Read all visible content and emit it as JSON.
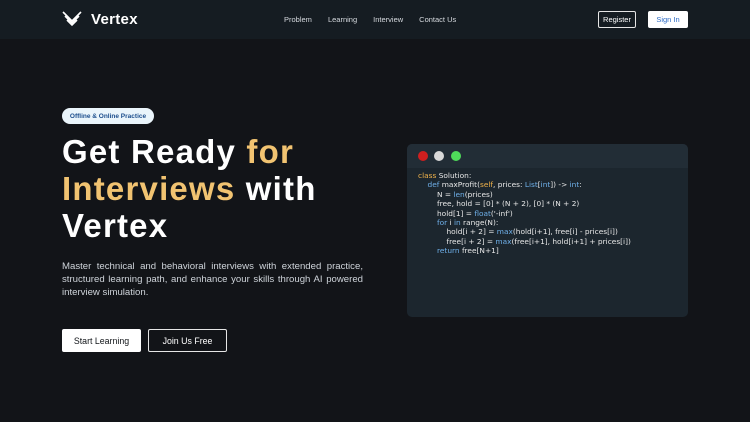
{
  "nav": {
    "brand": "Vertex",
    "links": [
      "Problem",
      "Learning",
      "Interview",
      "Contact Us"
    ],
    "register_label": "Register",
    "signin_label": "Sign In"
  },
  "hero": {
    "badge": "Offline & Online Practice",
    "headline": {
      "line1_a": "Get Ready ",
      "line1_b": "for",
      "line2_a": "Interviews",
      "line2_b": " with",
      "line3": "Vertex"
    },
    "description": "Master technical and behavioral interviews with extended practice, structured learning path, and enhance your skills through AI powered interview simulation.",
    "start_label": "Start Learning",
    "join_label": "Join Us Free"
  },
  "code": {
    "lines": [
      {
        "indent": 0,
        "tokens": [
          {
            "t": "class",
            "c": "kw"
          },
          {
            "t": " Solution:",
            "c": ""
          }
        ]
      },
      {
        "indent": 1,
        "tokens": [
          {
            "t": "def",
            "c": "bi"
          },
          {
            "t": " maxProfit(",
            "c": ""
          },
          {
            "t": "self",
            "c": "kw"
          },
          {
            "t": ", prices: ",
            "c": ""
          },
          {
            "t": "List",
            "c": "bi"
          },
          {
            "t": "[",
            "c": ""
          },
          {
            "t": "int",
            "c": "bi"
          },
          {
            "t": "]) -> ",
            "c": ""
          },
          {
            "t": "int",
            "c": "bi"
          },
          {
            "t": ":",
            "c": ""
          }
        ]
      },
      {
        "indent": 2,
        "tokens": [
          {
            "t": "N = ",
            "c": ""
          },
          {
            "t": "len",
            "c": "bi"
          },
          {
            "t": "(prices)",
            "c": ""
          }
        ]
      },
      {
        "indent": 2,
        "tokens": [
          {
            "t": "free, hold = [0] * (N + 2), [0] * (N + 2)",
            "c": ""
          }
        ]
      },
      {
        "indent": 2,
        "tokens": [
          {
            "t": "hold[1] = ",
            "c": ""
          },
          {
            "t": "float",
            "c": "bi"
          },
          {
            "t": "('-inf')",
            "c": ""
          }
        ]
      },
      {
        "indent": 2,
        "tokens": [
          {
            "t": "for",
            "c": "bi"
          },
          {
            "t": " i ",
            "c": ""
          },
          {
            "t": "in",
            "c": "bi"
          },
          {
            "t": " range(N):",
            "c": ""
          }
        ]
      },
      {
        "indent": 3,
        "tokens": [
          {
            "t": "hold[i + 2] = ",
            "c": ""
          },
          {
            "t": "max",
            "c": "bi"
          },
          {
            "t": "(hold[i+1], free[i] - prices[i])",
            "c": ""
          }
        ]
      },
      {
        "indent": 3,
        "tokens": [
          {
            "t": "free[i + 2] = ",
            "c": ""
          },
          {
            "t": "max",
            "c": "bi"
          },
          {
            "t": "(free[i+1], hold[i+1] + prices[i])",
            "c": ""
          }
        ]
      },
      {
        "indent": 2,
        "tokens": [
          {
            "t": "return",
            "c": "bi"
          },
          {
            "t": " free[N+1]",
            "c": ""
          }
        ]
      }
    ]
  },
  "colors": {
    "background": "#121418",
    "nav_background": "#151c22",
    "accent_yellow": "#f1c371",
    "keyword_orange": "#f0b24a",
    "builtin_blue": "#6fb0ea"
  },
  "icons": {
    "logo": "chevron-v-logo-icon"
  }
}
